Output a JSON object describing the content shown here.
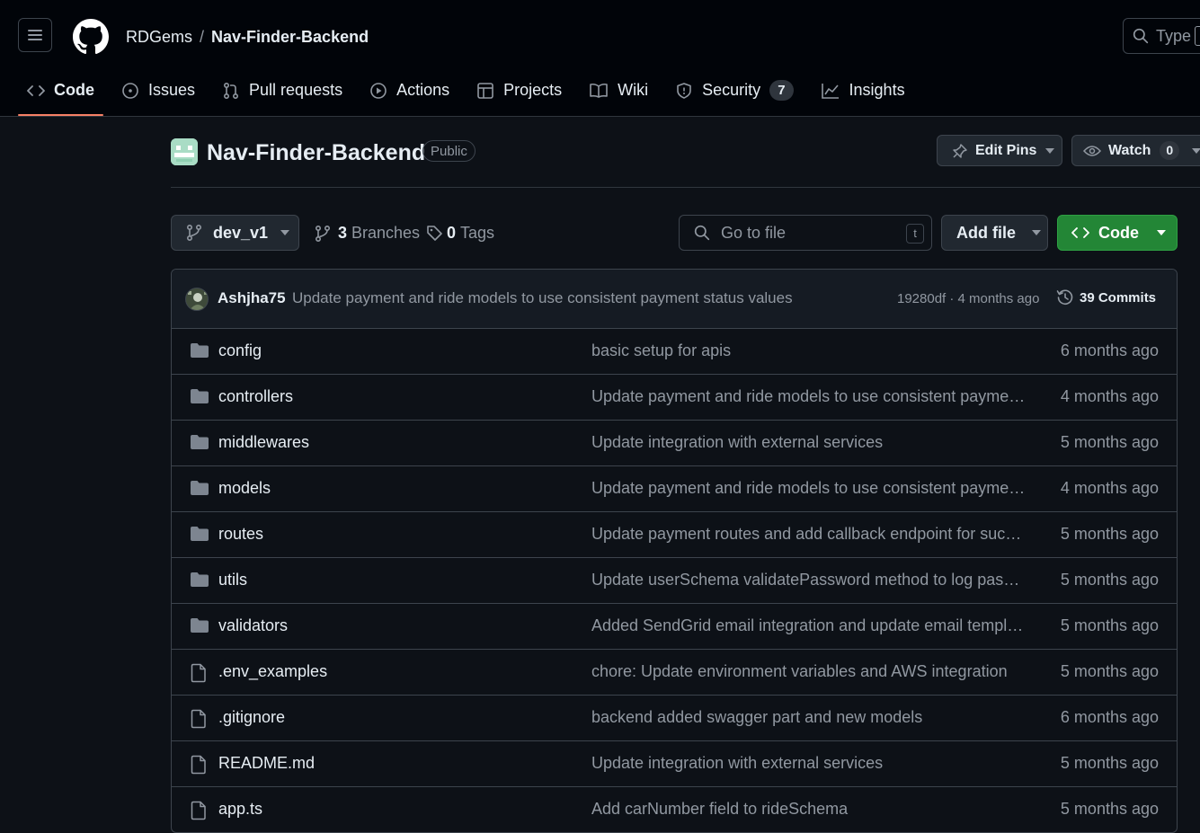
{
  "header": {
    "owner": "RDGems",
    "separator": "/",
    "repo": "Nav-Finder-Backend",
    "search_placeholder": "Type"
  },
  "tabs": [
    {
      "label": "Code",
      "icon": "code-icon",
      "active": true
    },
    {
      "label": "Issues",
      "icon": "issue-opened-icon"
    },
    {
      "label": "Pull requests",
      "icon": "git-pull-request-icon"
    },
    {
      "label": "Actions",
      "icon": "play-icon"
    },
    {
      "label": "Projects",
      "icon": "table-icon"
    },
    {
      "label": "Wiki",
      "icon": "book-icon"
    },
    {
      "label": "Security",
      "icon": "shield-icon",
      "count": "7"
    },
    {
      "label": "Insights",
      "icon": "graph-icon"
    }
  ],
  "repo_header": {
    "title": "Nav-Finder-Backend",
    "visibility": "Public",
    "edit_pins_label": "Edit Pins",
    "watch_label": "Watch",
    "watch_count": "0"
  },
  "toolbar": {
    "branch": "dev_v1",
    "branches_count": "3",
    "branches_label": "Branches",
    "tags_count": "0",
    "tags_label": "Tags",
    "goto_placeholder": "Go to file",
    "goto_shortcut": "t",
    "add_file_label": "Add file",
    "code_label": "Code"
  },
  "latest_commit": {
    "author": "Ashjha75",
    "message": "Update payment and ride models to use consistent payment status values",
    "meta": "19280df · 4 months ago",
    "commits_label": "39 Commits"
  },
  "files": [
    {
      "type": "dir",
      "name": "config",
      "message": "basic setup for apis",
      "date": "6 months ago"
    },
    {
      "type": "dir",
      "name": "controllers",
      "message": "Update payment and ride models to use consistent payment...",
      "date": "4 months ago"
    },
    {
      "type": "dir",
      "name": "middlewares",
      "message": "Update integration with external services",
      "date": "5 months ago"
    },
    {
      "type": "dir",
      "name": "models",
      "message": "Update payment and ride models to use consistent payment...",
      "date": "4 months ago"
    },
    {
      "type": "dir",
      "name": "routes",
      "message": "Update payment routes and add callback endpoint for succe...",
      "date": "5 months ago"
    },
    {
      "type": "dir",
      "name": "utils",
      "message": "Update userSchema validatePassword method to log passw...",
      "date": "5 months ago"
    },
    {
      "type": "dir",
      "name": "validators",
      "message": "Added SendGrid email integration and update email templat...",
      "date": "5 months ago"
    },
    {
      "type": "file",
      "name": ".env_examples",
      "message": "chore: Update environment variables and AWS integration",
      "date": "5 months ago"
    },
    {
      "type": "file",
      "name": ".gitignore",
      "message": "backend added swagger part and new models",
      "date": "6 months ago"
    },
    {
      "type": "file",
      "name": "README.md",
      "message": "Update integration with external services",
      "date": "5 months ago"
    },
    {
      "type": "file",
      "name": "app.ts",
      "message": "Add carNumber field to rideSchema",
      "date": "5 months ago"
    }
  ],
  "colors": {
    "background": "#0d1117",
    "header_bg": "#010409",
    "border": "#3d444d",
    "text": "#e6edf3",
    "muted": "#9198a1",
    "tab_underline": "#f78166",
    "green_button": "#238636",
    "folder_icon": "#7d8590"
  }
}
